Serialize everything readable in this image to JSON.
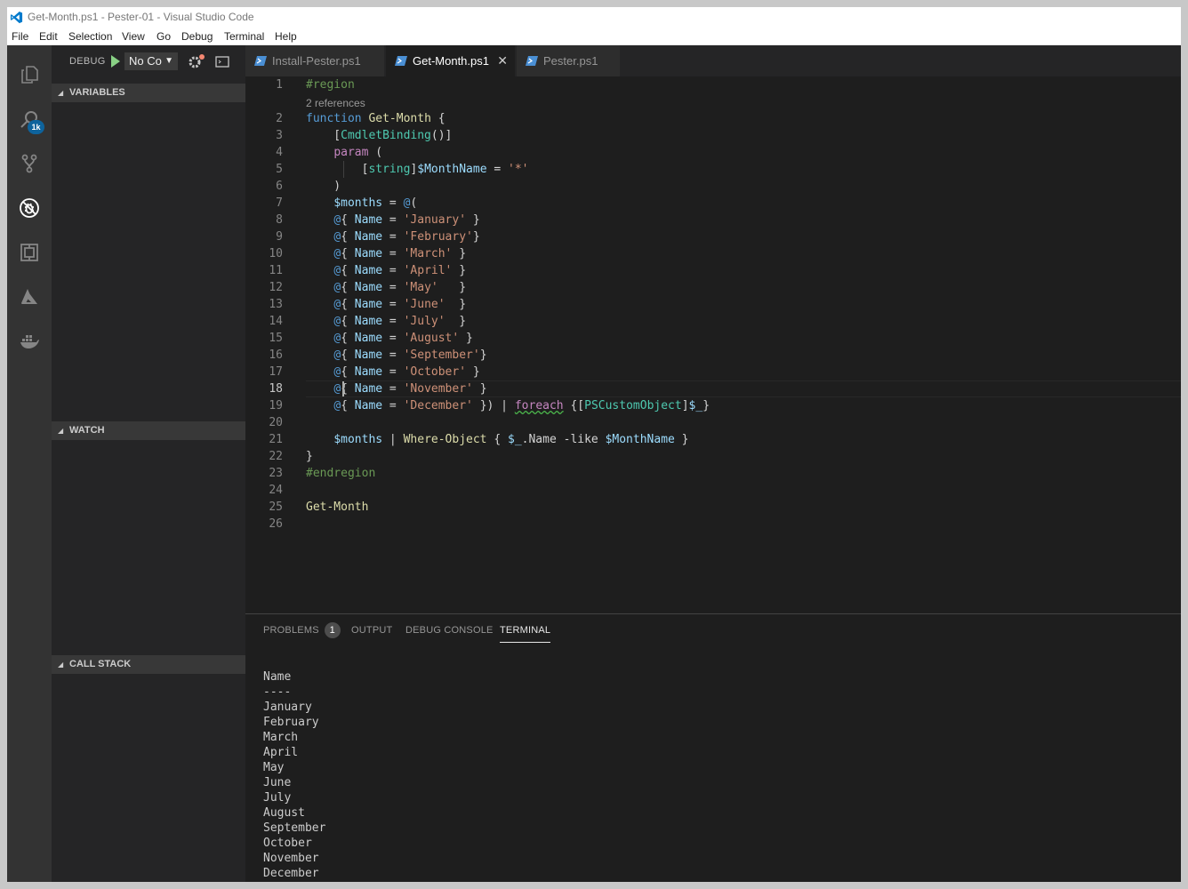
{
  "window": {
    "title": "Get-Month.ps1 - Pester-01 - Visual Studio Code"
  },
  "menu": [
    "File",
    "Edit",
    "Selection",
    "View",
    "Go",
    "Debug",
    "Terminal",
    "Help"
  ],
  "activity_bar": {
    "icons": [
      "explorer-icon",
      "search-icon",
      "source-control-icon",
      "debug-icon",
      "extensions-icon",
      "azure-icon",
      "docker-icon"
    ],
    "source_control_badge": "1k"
  },
  "debug": {
    "label": "DEBUG",
    "configuration": "No Co"
  },
  "sidebar": {
    "sections": [
      "VARIABLES",
      "WATCH",
      "CALL STACK"
    ]
  },
  "tabs": [
    {
      "label": "Install-Pester.ps1",
      "active": false
    },
    {
      "label": "Get-Month.ps1",
      "active": true,
      "close": "✕"
    },
    {
      "label": "Pester.ps1",
      "active": false
    }
  ],
  "editor": {
    "codelens": "2 references",
    "current_line": 18,
    "line_numbers": [
      "1",
      "2",
      "3",
      "4",
      "5",
      "6",
      "7",
      "8",
      "9",
      "10",
      "11",
      "12",
      "13",
      "14",
      "15",
      "16",
      "17",
      "18",
      "19",
      "20",
      "21",
      "22",
      "23",
      "24",
      "25",
      "26"
    ]
  },
  "panel": {
    "tabs": [
      "PROBLEMS",
      "OUTPUT",
      "DEBUG CONSOLE",
      "TERMINAL"
    ],
    "problems_count": "1",
    "active_tab": "TERMINAL",
    "terminal_lines": [
      "Name",
      "----",
      "January",
      "February",
      "March",
      "April",
      "May",
      "June",
      "July",
      "August",
      "September",
      "October",
      "November",
      "December"
    ]
  },
  "colors": {
    "accent": "#0e639c",
    "editor_bg": "#1e1e1e",
    "sidebar_bg": "#252526",
    "activity_bg": "#333333"
  }
}
